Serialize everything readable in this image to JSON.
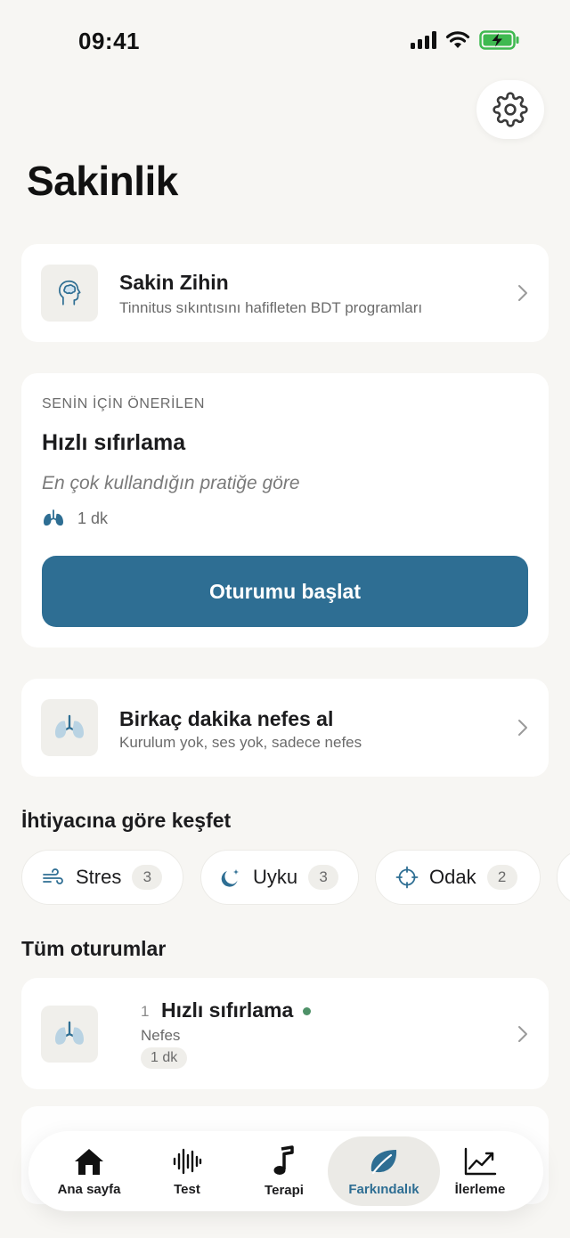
{
  "status_bar": {
    "time": "09:41"
  },
  "page": {
    "title": "Sakinlik"
  },
  "program_card": {
    "title": "Sakin Zihin",
    "subtitle": "Tinnitus sıkıntısını hafifleten BDT programları",
    "icon": "head-brain-icon"
  },
  "recommended": {
    "label": "SENİN İÇİN ÖNERİLEN",
    "title": "Hızlı sıfırlama",
    "subtitle": "En çok kullandığın pratiğe göre",
    "duration": "1 dk",
    "icon": "lungs-icon",
    "button_label": "Oturumu başlat",
    "accent_color": "#2e6e93"
  },
  "breath_card": {
    "title": "Birkaç dakika nefes al",
    "subtitle": "Kurulum yok, ses yok, sadece nefes",
    "icon": "lungs-icon"
  },
  "explore": {
    "title": "İhtiyacına göre keşfet",
    "chips": [
      {
        "label": "Stres",
        "count": "3",
        "icon": "wind-icon"
      },
      {
        "label": "Uyku",
        "count": "3",
        "icon": "moon-stars-icon"
      },
      {
        "label": "Odak",
        "count": "2",
        "icon": "crosshair-icon"
      }
    ]
  },
  "sessions": {
    "title": "Tüm oturumlar",
    "items": [
      {
        "number": "1",
        "title": "Hızlı sıfırlama",
        "category": "Nefes",
        "duration": "1 dk",
        "status_color": "#4e9168",
        "icon": "lungs-icon"
      }
    ]
  },
  "tab_bar": {
    "tabs": [
      {
        "label": "Ana sayfa",
        "icon": "home-icon",
        "active": false
      },
      {
        "label": "Test",
        "icon": "waveform-icon",
        "active": false
      },
      {
        "label": "Terapi",
        "icon": "music-note-icon",
        "active": false
      },
      {
        "label": "Farkındalık",
        "icon": "leaf-icon",
        "active": true
      },
      {
        "label": "İlerleme",
        "icon": "chart-line-icon",
        "active": false
      }
    ],
    "active_color": "#2e6e93"
  }
}
